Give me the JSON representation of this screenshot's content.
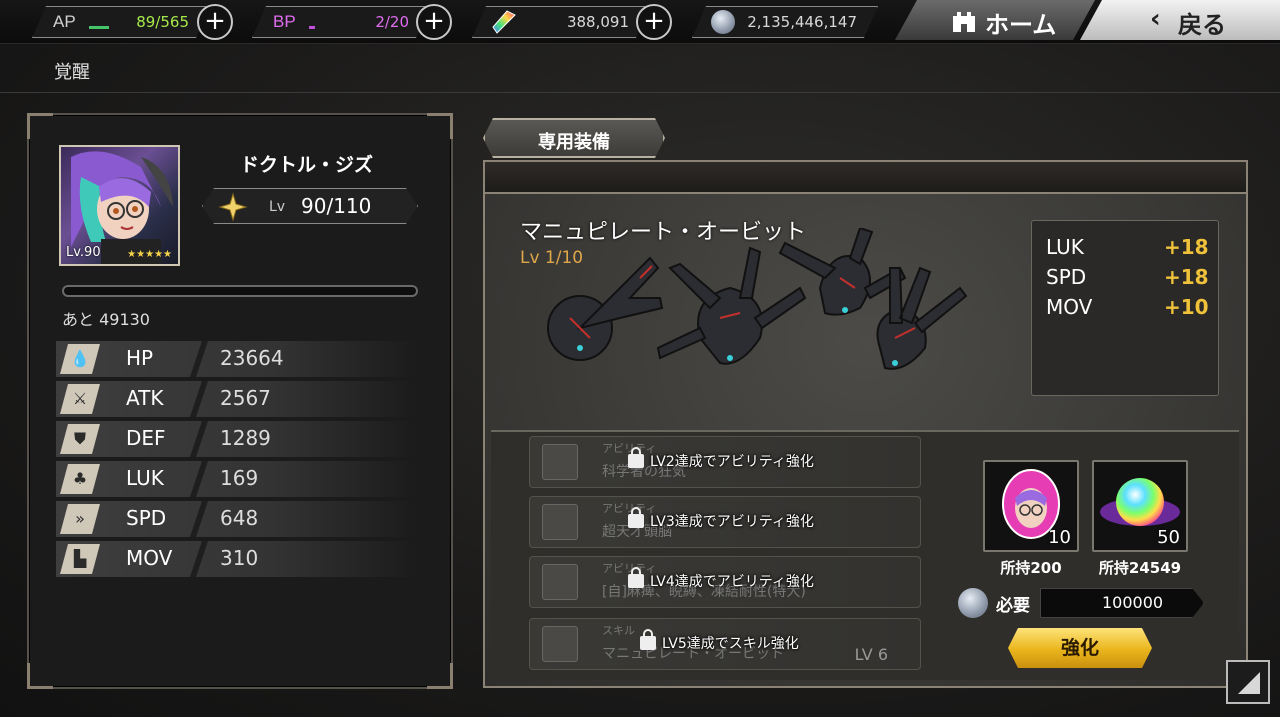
{
  "topbar": {
    "ap": {
      "label": "AP",
      "value": "89/565"
    },
    "bp": {
      "label": "BP",
      "value": "2/20"
    },
    "crystal": {
      "value": "388,091"
    },
    "coin": {
      "value": "2,135,446,147"
    },
    "home_label": "ホーム",
    "back_label": "戻る"
  },
  "page": {
    "title": "覚醒"
  },
  "character": {
    "name": "ドクトル・ジズ",
    "portrait_level": "Lv.90",
    "stars": "★★★★★",
    "lv_label": "Lv",
    "lv_value": "90/110",
    "exp_remaining": "あと 49130",
    "stats": [
      {
        "name": "HP",
        "value": "23664",
        "icon": "drop-icon"
      },
      {
        "name": "ATK",
        "value": "2567",
        "icon": "sword-icon"
      },
      {
        "name": "DEF",
        "value": "1289",
        "icon": "shield-icon"
      },
      {
        "name": "LUK",
        "value": "169",
        "icon": "clover-icon"
      },
      {
        "name": "SPD",
        "value": "648",
        "icon": "speed-icon"
      },
      {
        "name": "MOV",
        "value": "310",
        "icon": "boot-icon"
      }
    ]
  },
  "equipment": {
    "tab_label": "専用装備",
    "name": "マニュピレート・オービット",
    "level": "Lv 1/10",
    "bonuses": [
      {
        "stat": "LUK",
        "value": "+18"
      },
      {
        "stat": "SPD",
        "value": "+18"
      },
      {
        "stat": "MOV",
        "value": "+10"
      }
    ],
    "abilities": [
      {
        "kind": "アビリティ",
        "name": "科学者の狂気",
        "lock_text": "LV2達成でアビリティ強化",
        "lv": ""
      },
      {
        "kind": "アビリティ",
        "name": "超天才頭脳",
        "lock_text": "LV3達成でアビリティ強化",
        "lv": ""
      },
      {
        "kind": "アビリティ",
        "name": "[自]麻痺、睨縛、凍結耐性(特大)",
        "lock_text": "LV4達成でアビリティ強化",
        "lv": ""
      },
      {
        "kind": "スキル",
        "name": "マニュピレート・オービット",
        "lock_text": "LV5達成でスキル強化",
        "lv": "LV 6"
      }
    ],
    "materials": [
      {
        "count": "10",
        "owned": "所持200"
      },
      {
        "count": "50",
        "owned": "所持24549"
      }
    ],
    "cost_label": "必要",
    "cost_value": "100000",
    "enhance_label": "強化"
  },
  "colors": {
    "accent_gold": "#f0c23a",
    "ap_value": "#a6e84a",
    "bp_value": "#e06cf0",
    "equip_level": "#e0a64a"
  }
}
